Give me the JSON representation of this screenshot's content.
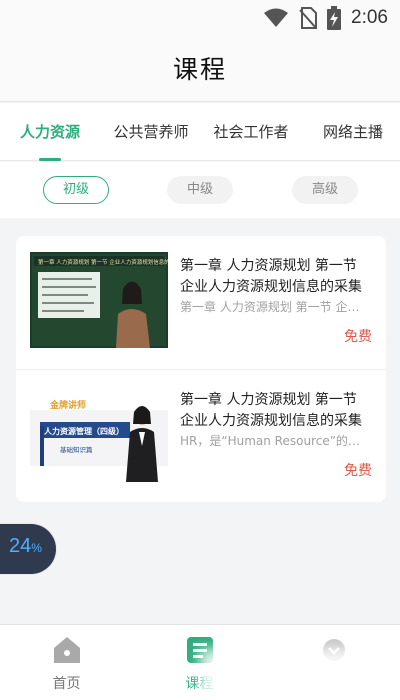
{
  "status_bar": {
    "time": "2:06",
    "icons": [
      "wifi-icon",
      "no-sim-icon",
      "battery-charging-icon"
    ]
  },
  "header": {
    "title": "课程"
  },
  "tabs": [
    {
      "label": "人力资源",
      "active": true
    },
    {
      "label": "公共营养师",
      "active": false
    },
    {
      "label": "社会工作者",
      "active": false
    },
    {
      "label": "网络主播",
      "active": false
    }
  ],
  "levels": [
    {
      "label": "初级",
      "active": true
    },
    {
      "label": "中级",
      "active": false
    },
    {
      "label": "高级",
      "active": false
    }
  ],
  "courses": [
    {
      "title": "第一章 人力资源规划 第一节 企业人力资源规划信息的采集与…",
      "subtitle": "第一章 人力资源规划 第一节 企业…",
      "price": "免费",
      "thumb_caption": "第一章 人力资源规划 第一节 企业人力资源规划信息的采集与"
    },
    {
      "title": "第一章 人力资源规划 第一节 企业人力资源规划信息的采集与…",
      "subtitle": "HR，是“Human Resource”的…",
      "price": "免费",
      "thumb_badge": "金牌讲师",
      "thumb_title": "人力资源管理（四级）",
      "thumb_sub": "基础知识篇"
    }
  ],
  "progress": {
    "value": "24",
    "unit": "%"
  },
  "bottom_nav": [
    {
      "label": "首页",
      "icon": "home-icon",
      "active": false
    },
    {
      "label": "课程",
      "icon": "course-icon",
      "active": true
    },
    {
      "label": "",
      "icon": "profile-icon",
      "active": false
    }
  ],
  "colors": {
    "accent": "#2fae7d",
    "price": "#e0574a",
    "progress_text": "#4fb0ff",
    "progress_bg": "#2f3a4f"
  }
}
